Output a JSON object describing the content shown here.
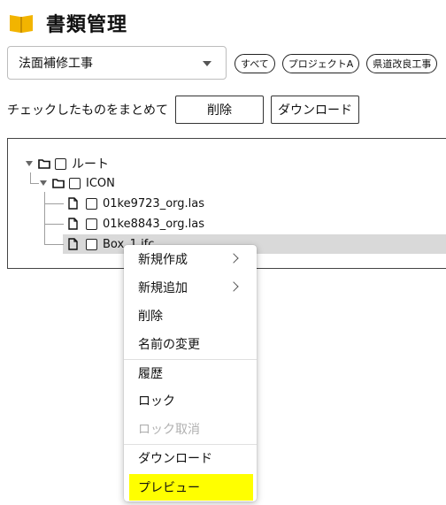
{
  "header": {
    "title": "書類管理",
    "icon": "book-icon",
    "accent": "#f2b400"
  },
  "project_select": {
    "value": "法面補修工事"
  },
  "filters": [
    {
      "label": "すべて"
    },
    {
      "label": "プロジェクトA"
    },
    {
      "label": "県道改良工事"
    }
  ],
  "bulk": {
    "label": "チェックしたものをまとめて",
    "delete_label": "削除",
    "download_label": "ダウンロード"
  },
  "tree": {
    "root": {
      "label": "ルート"
    },
    "folder": {
      "label": "ICON"
    },
    "files": [
      {
        "label": "01ke9723_org.las"
      },
      {
        "label": "01ke8843_org.las"
      },
      {
        "label": "Box_1.ifc"
      }
    ]
  },
  "context_menu": {
    "items": [
      {
        "label": "新規作成",
        "submenu": true
      },
      {
        "label": "新規追加",
        "submenu": true
      },
      {
        "label": "削除"
      },
      {
        "label": "名前の変更"
      },
      {
        "label": "履歴"
      },
      {
        "label": "ロック"
      },
      {
        "label": "ロック取消",
        "disabled": true
      },
      {
        "label": "ダウンロード"
      },
      {
        "label": "プレビュー",
        "highlighted": true
      }
    ],
    "highlight_color": "#ffff00"
  }
}
